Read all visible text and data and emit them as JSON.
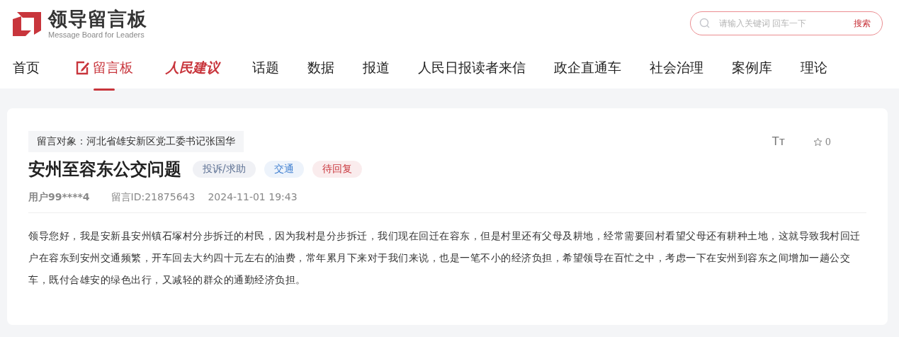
{
  "logo": {
    "title": "领导留言板",
    "subtitle": "Message Board for Leaders"
  },
  "search": {
    "placeholder": "请输入关键词 回车一下",
    "button": "搜索"
  },
  "nav": [
    {
      "label": "首页",
      "kind": "plain",
      "selected": false
    },
    {
      "label": "留言板",
      "kind": "icon",
      "selected": true
    },
    {
      "label": "人民建议",
      "kind": "brand",
      "selected": false
    },
    {
      "label": "话题",
      "kind": "plain",
      "selected": false
    },
    {
      "label": "数据",
      "kind": "plain",
      "selected": false
    },
    {
      "label": "报道",
      "kind": "plain",
      "selected": false
    },
    {
      "label": "人民日报读者来信",
      "kind": "plain",
      "selected": false
    },
    {
      "label": "政企直通车",
      "kind": "plain",
      "selected": false
    },
    {
      "label": "社会治理",
      "kind": "plain",
      "selected": false
    },
    {
      "label": "案例库",
      "kind": "plain",
      "selected": false
    },
    {
      "label": "理论",
      "kind": "plain",
      "selected": false
    }
  ],
  "message": {
    "target": "留言对象：河北省雄安新区党工委书记张国华",
    "title": "安州至容东公交问题",
    "tags": [
      {
        "label": "投诉/求助",
        "color": "#5b6f92"
      },
      {
        "label": "交通",
        "color": "#3f7fd0"
      },
      {
        "label": "待回复",
        "color": "#c8353c"
      }
    ],
    "font_toggle": "Tт",
    "favorites": "0",
    "user": "用户99****4",
    "id": "留言ID:21875643",
    "time": "2024-11-01 19:43",
    "body": "领导您好，我是安新县安州镇石塚村分步拆迁的村民，因为我村是分步拆迁，我们现在回迁在容东，但是村里还有父母及耕地，经常需要回村看望父母还有耕种土地，这就导致我村回迁户在容东到安州交通频繁，开车回去大约四十元左右的油费，常年累月下来对于我们来说，也是一笔不小的经济负担，希望领导在百忙之中，考虑一下在安州到容东之间增加一趟公交车，既付合雄安的绿色出行，又减轻的群众的通勤经济负担。"
  }
}
